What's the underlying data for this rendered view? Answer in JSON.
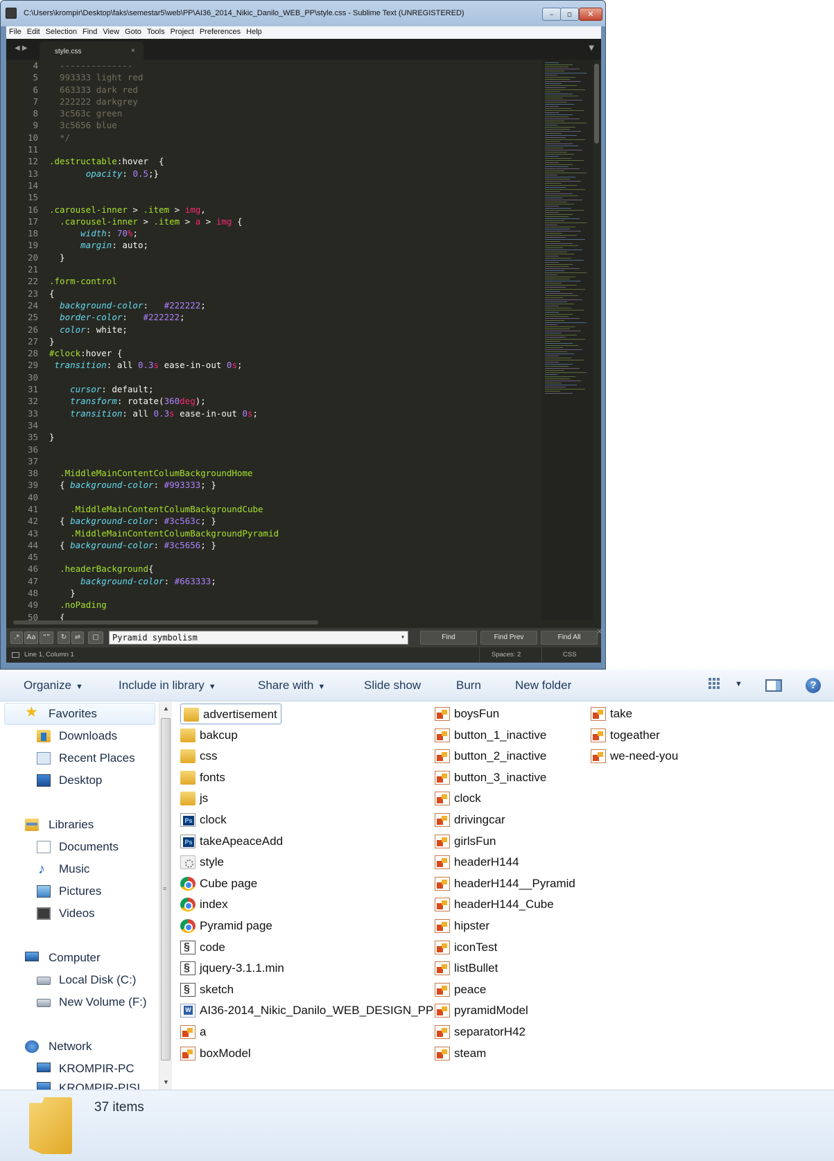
{
  "sublime": {
    "title": "C:\\Users\\krompir\\Desktop\\faks\\semestar5\\web\\PP\\AI36_2014_Nikic_Danilo_WEB_PP\\style.css - Sublime Text (UNREGISTERED)",
    "window_buttons": {
      "minimize": "–",
      "maximize": "▫",
      "close": "✕"
    },
    "menu": [
      "File",
      "Edit",
      "Selection",
      "Find",
      "View",
      "Goto",
      "Tools",
      "Project",
      "Preferences",
      "Help"
    ],
    "tab_nav": "◀ ▶",
    "tab": {
      "name": "style.css",
      "close": "×"
    },
    "tab_menu": "▼",
    "line_numbers": [
      "4",
      "5",
      "6",
      "7",
      "8",
      "9",
      "10",
      "11",
      "12",
      "13",
      "14",
      "15",
      "16",
      "17",
      "18",
      "19",
      "20",
      "21",
      "22",
      "23",
      "24",
      "25",
      "26",
      "27",
      "28",
      "29",
      "30",
      "31",
      "32",
      "33",
      "34",
      "35",
      "36",
      "37",
      "38",
      "39",
      "40",
      "41",
      "42",
      "43",
      "44",
      "45",
      "46",
      "47",
      "48",
      "49",
      "50"
    ],
    "find_toggles": [
      ".*",
      "Aa",
      "“”",
      "↻",
      "⇌",
      "▢"
    ],
    "find_value": "Pyramid symbolism",
    "find_dropdown": "▾",
    "find_buttons": {
      "find": "Find",
      "find_prev": "Find Prev",
      "find_all": "Find All"
    },
    "find_close": "×",
    "status": {
      "position": "Line 1, Column 1",
      "spaces": "Spaces: 2",
      "syntax": "CSS"
    },
    "colors": {
      "bg": "#272822",
      "comment": "#75715e",
      "selector": "#a6e22e",
      "property": "#66d9ef",
      "number": "#ae81ff",
      "unit": "#f92672"
    }
  },
  "explorer": {
    "toolbar": {
      "organize": "Organize",
      "include": "Include in library",
      "share": "Share with",
      "slideshow": "Slide show",
      "burn": "Burn",
      "new_folder": "New folder",
      "dropdown": "▼",
      "help": "?"
    },
    "nav": {
      "favorites": "Favorites",
      "downloads": "Downloads",
      "recent": "Recent Places",
      "desktop": "Desktop",
      "libraries": "Libraries",
      "documents": "Documents",
      "music": "Music",
      "pictures": "Pictures",
      "videos": "Videos",
      "computer": "Computer",
      "local_disk": "Local Disk (C:)",
      "new_volume": "New Volume (F:)",
      "network": "Network",
      "pc1": "KROMPIR-PC",
      "pc2": "KROMPIR-PISI",
      "scroll_up": "▲",
      "scroll_down": "▼",
      "grip": "≡",
      "star": "★",
      "note": "♪"
    },
    "files": {
      "col1": [
        "advertisement",
        "bakcup",
        "css",
        "fonts",
        "js",
        "clock",
        "takeApeaceAdd",
        "style",
        "Cube page",
        "index",
        "Pyramid page",
        "code",
        "jquery-3.1.1.min",
        "sketch",
        "AI36-2014_Nikic_Danilo_WEB_DESIGN_PP",
        "a",
        "boxModel"
      ],
      "col2": [
        "boysFun",
        "button_1_inactive",
        "button_2_inactive",
        "button_3_inactive",
        "clock",
        "drivingcar",
        "girlsFun",
        "headerH144",
        "headerH144__Pyramid",
        "headerH144_Cube",
        "hipster",
        "iconTest",
        "listBullet",
        "peace",
        "pyramidModel",
        "separatorH42",
        "steam"
      ],
      "col3": [
        "take",
        "togeather",
        "we-need-you"
      ]
    },
    "item_count": "37 items"
  }
}
